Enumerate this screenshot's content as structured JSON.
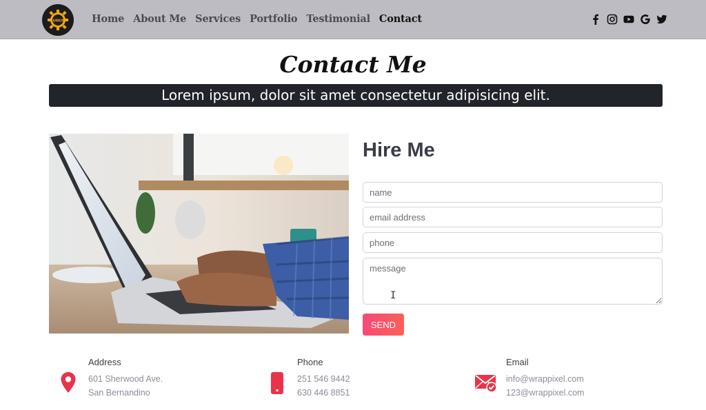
{
  "brand": {
    "logo_text": "SUNUM"
  },
  "nav": {
    "items": [
      {
        "label": "Home"
      },
      {
        "label": "About Me"
      },
      {
        "label": "Services"
      },
      {
        "label": "Portfolio"
      },
      {
        "label": "Testimonial"
      },
      {
        "label": "Contact",
        "active": true
      }
    ]
  },
  "socials": [
    "facebook-icon",
    "instagram-icon",
    "youtube-icon",
    "google-icon",
    "twitter-icon"
  ],
  "hero": {
    "title": "Contact Me",
    "subtitle": "Lorem ipsum, dolor sit amet consectetur adipisicing elit."
  },
  "form": {
    "title": "Hire Me",
    "name_placeholder": "name",
    "email_placeholder": "email address",
    "phone_placeholder": "phone",
    "message_placeholder": "message",
    "send_label": "SEND"
  },
  "contact": {
    "address": {
      "label": "Address",
      "line1": "601 Sherwood Ave.",
      "line2": "San Bernandino",
      "icon": "map-pin-icon"
    },
    "phone": {
      "label": "Phone",
      "line1": "251 546 9442",
      "line2": "630 446 8851",
      "icon": "mobile-phone-icon"
    },
    "email": {
      "label": "Email",
      "line1": "info@wrappixel.com",
      "line2": "123@wrappixel.com",
      "icon": "email-check-icon"
    }
  },
  "colors": {
    "accent": "#e8334a",
    "button_start": "#f64a77",
    "button_end": "#fc5f5a",
    "navbar": "#bdbcc2",
    "banner": "#212429"
  }
}
